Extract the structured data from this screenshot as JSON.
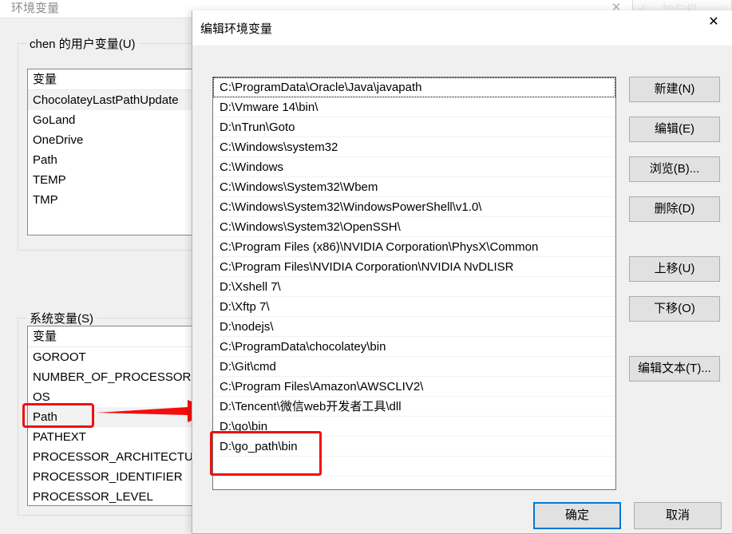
{
  "background_window": {
    "title": "环境变量",
    "close_label": "✕",
    "user_group": {
      "legend": "chen 的用户变量(U)",
      "column_header": "变量",
      "rows": [
        "ChocolateyLastPathUpdate",
        "GoLand",
        "OneDrive",
        "Path",
        "TEMP",
        "TMP"
      ],
      "selected_index": 0
    },
    "system_group": {
      "legend": "系统变量(S)",
      "column_header": "变量",
      "rows": [
        "GOROOT",
        "NUMBER_OF_PROCESSORS",
        "OS",
        "Path",
        "PATHEXT",
        "PROCESSOR_ARCHITECTUR",
        "PROCESSOR_IDENTIFIER",
        "PROCESSOR_LEVEL"
      ],
      "selected_index": 3
    }
  },
  "watermark": {
    "text": "加与机",
    "chevron": "✓"
  },
  "dialog": {
    "title": "编辑环境变量",
    "close_label": "✕",
    "path_entries": [
      "C:\\ProgramData\\Oracle\\Java\\javapath",
      "D:\\Vmware 14\\bin\\",
      "D:\\nTrun\\Goto",
      "C:\\Windows\\system32",
      "C:\\Windows",
      "C:\\Windows\\System32\\Wbem",
      "C:\\Windows\\System32\\WindowsPowerShell\\v1.0\\",
      "C:\\Windows\\System32\\OpenSSH\\",
      "C:\\Program Files (x86)\\NVIDIA Corporation\\PhysX\\Common",
      "C:\\Program Files\\NVIDIA Corporation\\NVIDIA NvDLISR",
      "D:\\Xshell 7\\",
      "D:\\Xftp 7\\",
      "D:\\nodejs\\",
      "C:\\ProgramData\\chocolatey\\bin",
      "D:\\Git\\cmd",
      "C:\\Program Files\\Amazon\\AWSCLIV2\\",
      "D:\\Tencent\\微信web开发者工具\\dll",
      "D:\\go\\bin",
      "D:\\go_path\\bin"
    ],
    "focused_index": 0,
    "empty_rows": 3,
    "buttons": {
      "new": "新建(N)",
      "edit": "编辑(E)",
      "browse": "浏览(B)...",
      "delete": "删除(D)",
      "move_up": "上移(U)",
      "move_down": "下移(O)",
      "edit_text": "编辑文本(T)...",
      "ok": "确定",
      "cancel": "取消"
    }
  },
  "annotations": {
    "color": "#f40d0d",
    "highlighted_variable": "Path",
    "highlighted_entries": [
      "D:\\go\\bin",
      "D:\\go_path\\bin"
    ]
  }
}
